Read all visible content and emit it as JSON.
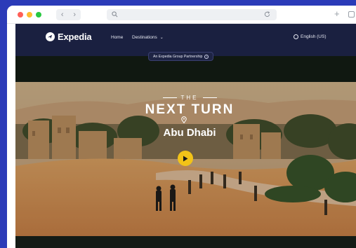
{
  "browser": {
    "back_icon": "chevron-left-icon",
    "forward_icon": "chevron-right-icon",
    "back_glyph": "‹",
    "forward_glyph": "›",
    "new_tab_glyph": "+"
  },
  "header": {
    "brand": "Expedia",
    "nav": {
      "home": "Home",
      "destinations": "Destinations",
      "destinations_caret": "⌄"
    },
    "language": "English (US)",
    "partnership_badge": "An Expedia Group Partnership",
    "partnership_info": "i"
  },
  "hero": {
    "eyebrow": "THE",
    "headline": "NEXT TURN",
    "destination": "Abu Dhabi",
    "play_icon": "play-icon"
  },
  "colors": {
    "header_bg": "#1a2040",
    "accent_play": "#f2c318",
    "desktop_bg": "#2b3bb8"
  }
}
